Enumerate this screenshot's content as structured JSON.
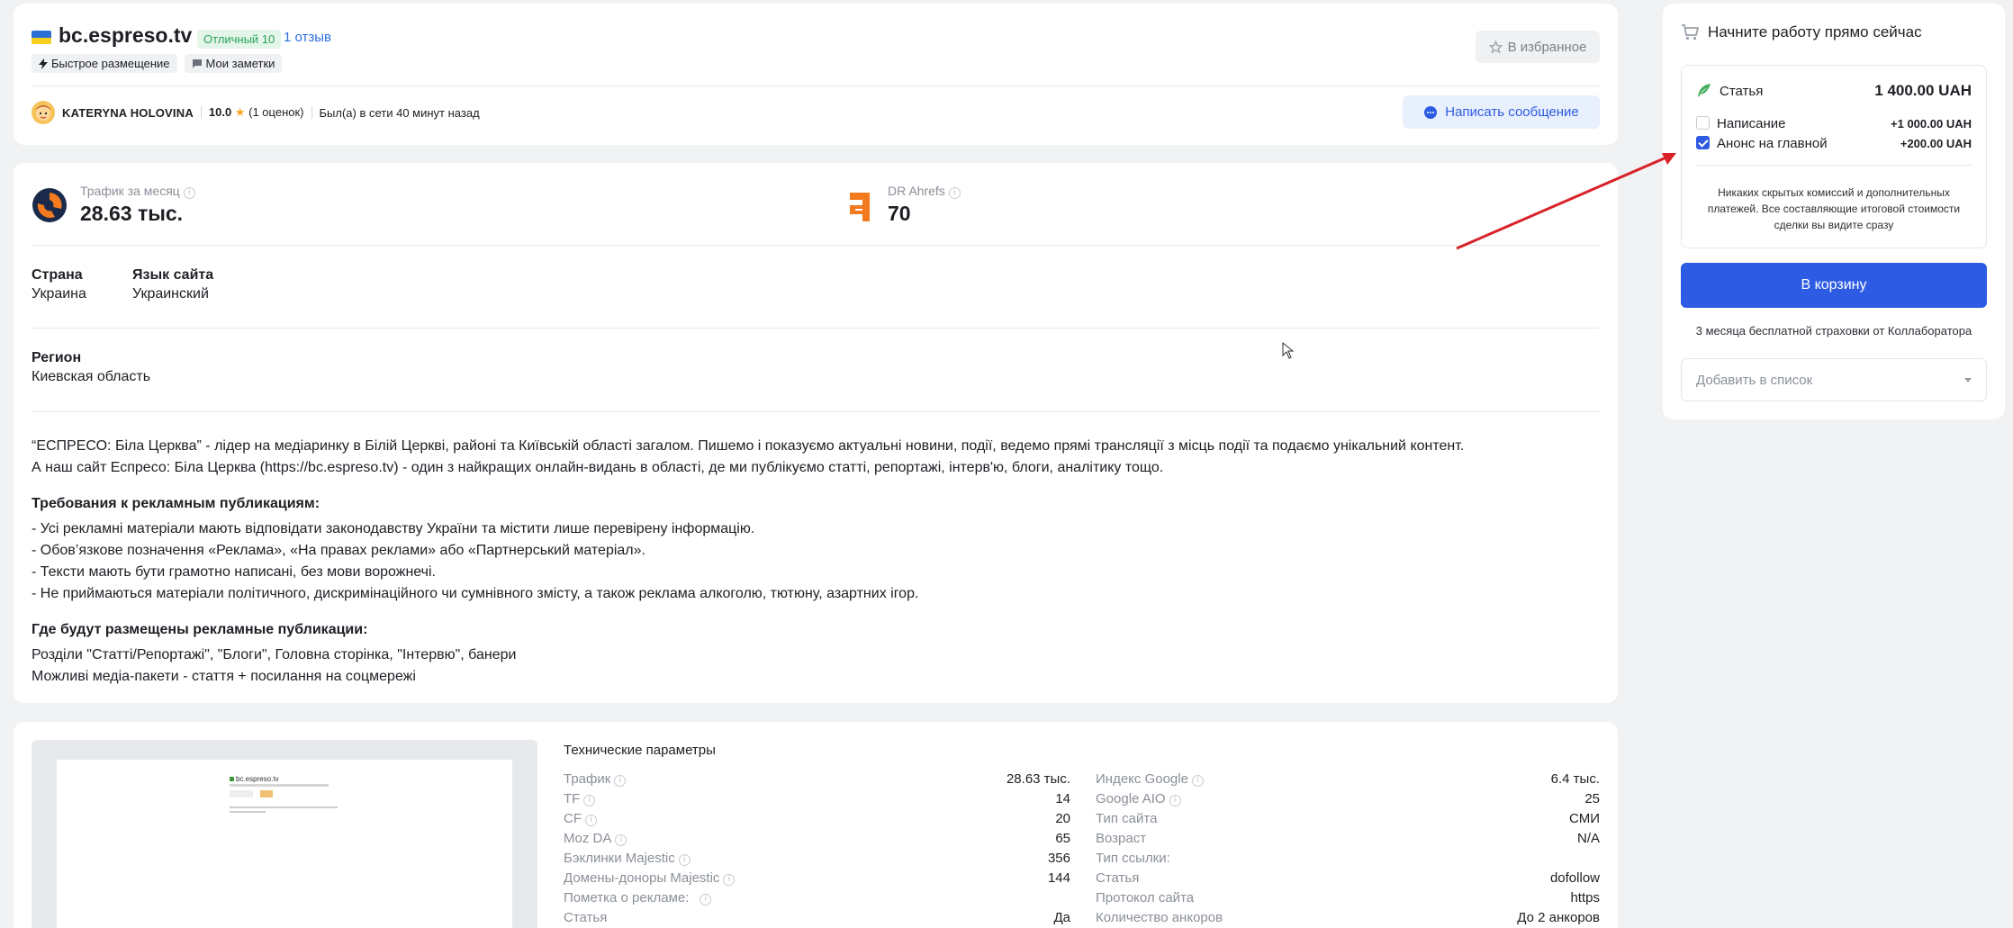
{
  "site": {
    "name": "bc.espreso.tv",
    "rating_badge": "Отличный 10",
    "reviews_link": "1 отзыв",
    "tags": [
      {
        "icon": "lightning-icon",
        "label": "Быстрое размещение"
      },
      {
        "icon": "note-icon",
        "label": "Мои заметки"
      }
    ],
    "favorite_label": "В избранное",
    "author_name": "KATERYNA HOLOVINA",
    "author_score": "10.0",
    "author_votes": "(1 оценок)",
    "author_online": "Был(а) в сети 40 минут назад",
    "message_label": "Написать сообщение"
  },
  "metrics": {
    "traffic_label": "Трафик за месяц",
    "traffic_value": "28.63 тыс.",
    "dr_label": "DR Ahrefs",
    "dr_value": "70"
  },
  "fields": {
    "country_label": "Страна",
    "country_value": "Украина",
    "lang_label": "Язык сайта",
    "lang_value": "Украинский",
    "region_label": "Регион",
    "region_value": "Киевская область"
  },
  "description": {
    "p1": "“ЕСПРЕСО: Біла Церква” - лідер на медіаринку в Білій Церкві, районі та Київській області загалом. Пишемо і показуємо актуальні новини, події, ведемо прямі трансляції з місць події та подаємо унікальний контент.",
    "p2": "А наш сайт Еспресо: Біла Церква (https://bc.espreso.tv) - один з найкращих онлайн-видань в області, де ми публікуємо статті, репортажі, інтерв'ю, блоги, аналітику тощо.",
    "req_title": "Требования к рекламным публикациям:",
    "req": [
      "- Усі рекламні матеріали мають відповідати законодавству України та містити лише перевірену інформацію.",
      "- Обов’язкове позначення «Реклама», «На правах реклами» або «Партнерський матеріал».",
      "- Тексти мають бути грамотно написані, без мови ворожнечі.",
      "- Не приймаються матеріали політичного, дискримінаційного чи сумнівного змісту, а також реклама алкоголю, тютюну, азартних ігор."
    ],
    "where_title": "Где будут размещены рекламные публикации:",
    "where": [
      "Розділи \"Статті/Репортажі\", \"Блоги\", Головна сторінка, \"Інтервю\", банери",
      "Можливі медіа-пакети - стаття + посилання на соцмережі"
    ]
  },
  "tech": {
    "title": "Технические параметры",
    "left": [
      {
        "k": "Трафик",
        "v": "28.63 тыс.",
        "info": true
      },
      {
        "k": "TF",
        "v": "14",
        "info": true
      },
      {
        "k": "CF",
        "v": "20",
        "info": true
      },
      {
        "k": "Moz DA",
        "v": "65",
        "info": true
      },
      {
        "k": "Бэклинки Majestic",
        "v": "356",
        "info": true
      },
      {
        "k": "Домены-доноры Majestic",
        "v": "144",
        "info": true
      },
      {
        "k": "Пометка о рекламе:",
        "v": "",
        "info": true
      },
      {
        "k": "Статья",
        "v": "Да",
        "info": false
      }
    ],
    "right": [
      {
        "k": "Индекс Google",
        "v": "6.4 тыс.",
        "info": true
      },
      {
        "k": "Google AIO",
        "v": "25",
        "info": true
      },
      {
        "k": "Тип сайта",
        "v": "СМИ",
        "info": false
      },
      {
        "k": "Возраст",
        "v": "N/A",
        "info": false
      },
      {
        "k": "Тип ссылки:",
        "v": "",
        "info": false
      },
      {
        "k": "Статья",
        "v": "dofollow",
        "info": false
      },
      {
        "k": "Протокол сайта",
        "v": "https",
        "info": false
      },
      {
        "k": "Количество анкоров",
        "v": "До 2 анкоров",
        "info": false
      }
    ],
    "thumb_site": "bc.espreso.tv"
  },
  "cart": {
    "title": "Начните работу прямо сейчас",
    "article_label": "Статья",
    "article_price": "1 400.00 UAH",
    "options": [
      {
        "label": "Написание",
        "price": "+1 000.00 UAH",
        "checked": false
      },
      {
        "label": "Анонс на главной",
        "price": "+200.00 UAH",
        "checked": true
      }
    ],
    "note": "Никаких скрытых комиссий и дополнительных платежей. Все составляющие итоговой стоимости сделки вы видите сразу",
    "button": "В корзину",
    "insurance": "3 месяца бесплатной страховки от Коллаборатора",
    "list_placeholder": "Добавить в список"
  },
  "colors": {
    "accent": "#2d5be3",
    "arrow": "#d8222a",
    "rating_green": "#28a35a"
  }
}
